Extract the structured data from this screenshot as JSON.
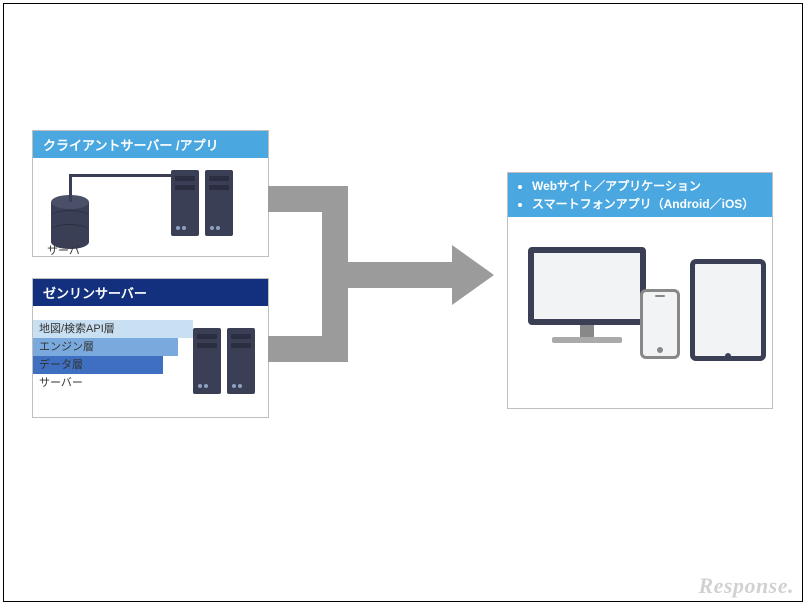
{
  "client_panel": {
    "title": "クライアントサーバー /アプリ",
    "db_label": "サーバ"
  },
  "zenrin_panel": {
    "title": "ゼンリンサーバー",
    "layers": {
      "l1": "地図/検索API層",
      "l2": "エンジン層",
      "l3": "データ層",
      "l4": "サーバー"
    }
  },
  "output_panel": {
    "bullets": {
      "b1": "Webサイト／アプリケーション",
      "b2": "スマートフォンアプリ（Android／iOS）"
    }
  },
  "watermark": "Response."
}
